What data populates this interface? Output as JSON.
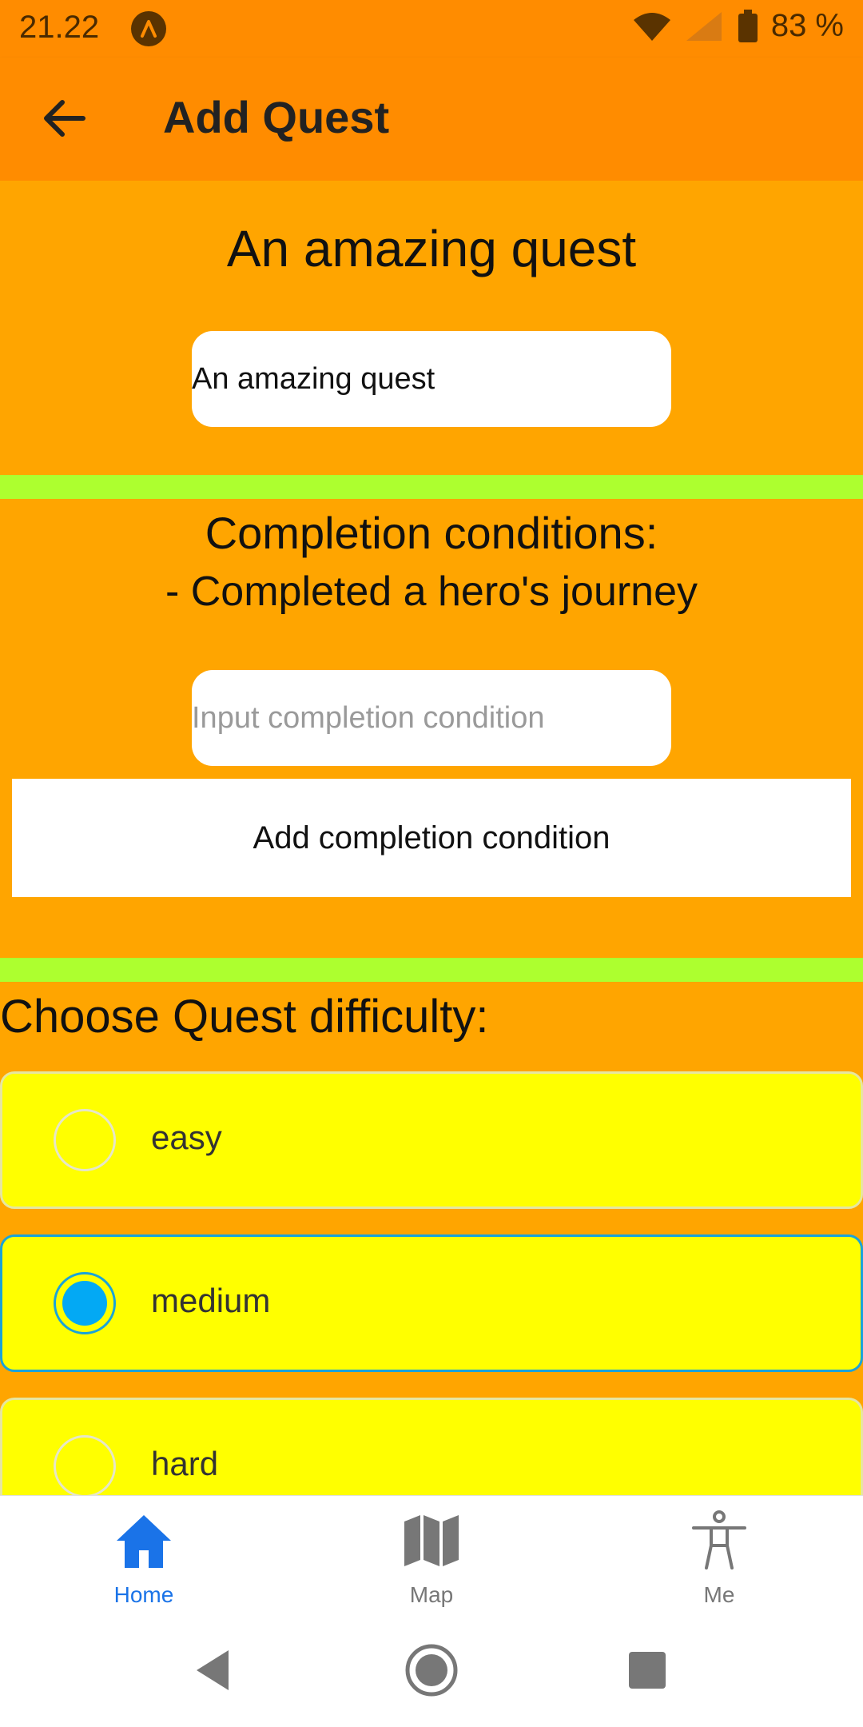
{
  "status_bar": {
    "time": "21.22",
    "battery": "83 %"
  },
  "app_bar": {
    "title": "Add Quest",
    "back_icon": "arrow-left-icon"
  },
  "quest": {
    "display_title": "An amazing quest",
    "name_value": "An amazing quest"
  },
  "completion": {
    "heading": "Completion conditions:",
    "items": [
      "- Completed a hero's journey"
    ],
    "input_placeholder": "Input completion condition",
    "add_button": "Add completion condition"
  },
  "difficulty": {
    "heading": "Choose Quest difficulty:",
    "options": [
      {
        "label": "easy",
        "selected": false
      },
      {
        "label": "medium",
        "selected": true
      },
      {
        "label": "hard",
        "selected": false
      }
    ]
  },
  "bottom_nav": {
    "items": [
      {
        "label": "Home",
        "icon": "home-icon",
        "active": true
      },
      {
        "label": "Map",
        "icon": "map-icon",
        "active": false
      },
      {
        "label": "Me",
        "icon": "person-icon",
        "active": false
      }
    ]
  },
  "colors": {
    "app_bar": "#FF8C00",
    "background": "#FFA500",
    "divider": "#ADFF2F",
    "option_background": "#FFFF00",
    "accent": "#03A9F4",
    "nav_active": "#1a73e8"
  }
}
